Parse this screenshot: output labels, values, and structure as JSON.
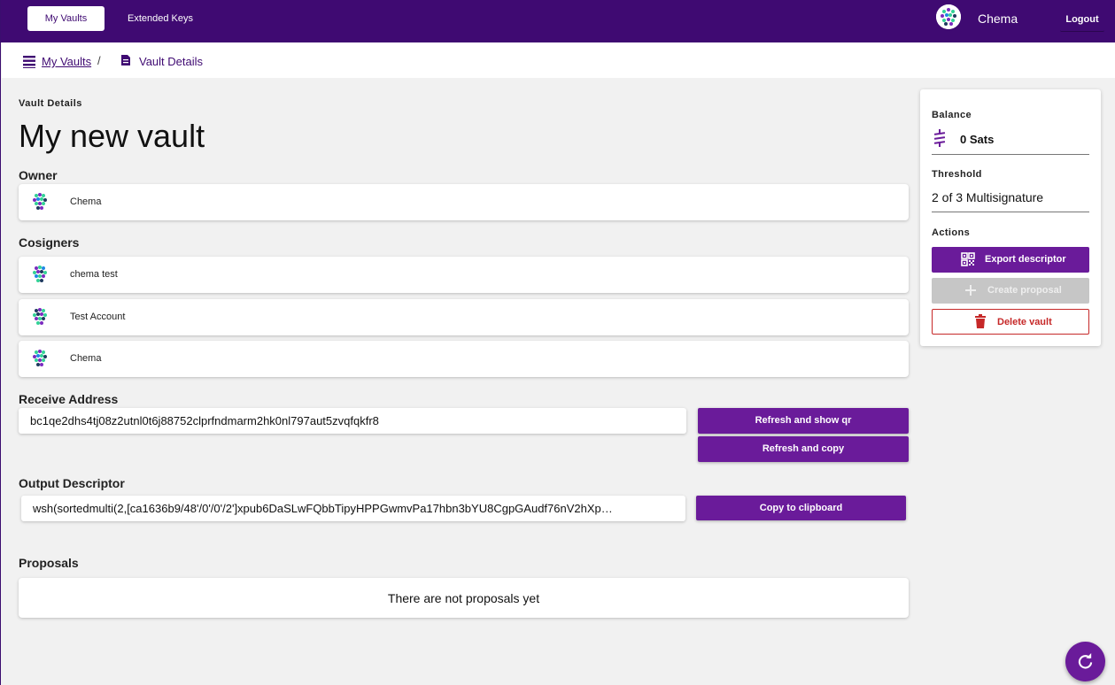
{
  "nav": {
    "tabs": [
      {
        "label": "My Vaults",
        "active": true
      },
      {
        "label": "Extended Keys",
        "active": false
      }
    ],
    "user": "Chema",
    "logout": "Logout"
  },
  "breadcrumb": {
    "root": "My Vaults",
    "separator": "/",
    "current": "Vault Details"
  },
  "vault": {
    "overline": "Vault Details",
    "name": "My new vault",
    "owner_label": "Owner",
    "owner": "Chema",
    "cosigners_label": "Cosigners",
    "cosigners": [
      "chema test",
      "Test Account",
      "Chema"
    ],
    "receive_label": "Receive Address",
    "receive_address": "bc1qe2dhs4tj08z2utnl0t6j88752clprfndmarm2hk0nl797aut5zvqfqkfr8",
    "refresh_qr": "Refresh and show qr",
    "refresh_copy": "Refresh and copy",
    "descriptor_label": "Output Descriptor",
    "descriptor": "wsh(sortedmulti(2,[ca1636b9/48'/0'/0'/2']xpub6DaSLwFQbbTipyHPPGwmvPa17hbn3bYU8CgpGAudf76nV2hXp…",
    "copy_clipboard": "Copy to clipboard",
    "proposals_label": "Proposals",
    "proposals_empty": "There are not proposals yet"
  },
  "panel": {
    "balance_label": "Balance",
    "balance": "0 Sats",
    "threshold_label": "Threshold",
    "threshold": "2 of 3 Multisignature",
    "actions_label": "Actions",
    "export": "Export descriptor",
    "create": "Create proposal",
    "delete": "Delete vault"
  },
  "colors": {
    "primary": "#3f0a72",
    "button": "#6a1b9a",
    "danger": "#c62828",
    "disabled": "#c6c6c6"
  },
  "icons": {
    "breadcrumb_root": "list-icon",
    "breadcrumb_current": "document-icon",
    "balance": "sats-icon",
    "export": "qr-code-icon",
    "create": "plus-icon",
    "delete": "trash-icon",
    "fab": "refresh-icon"
  }
}
